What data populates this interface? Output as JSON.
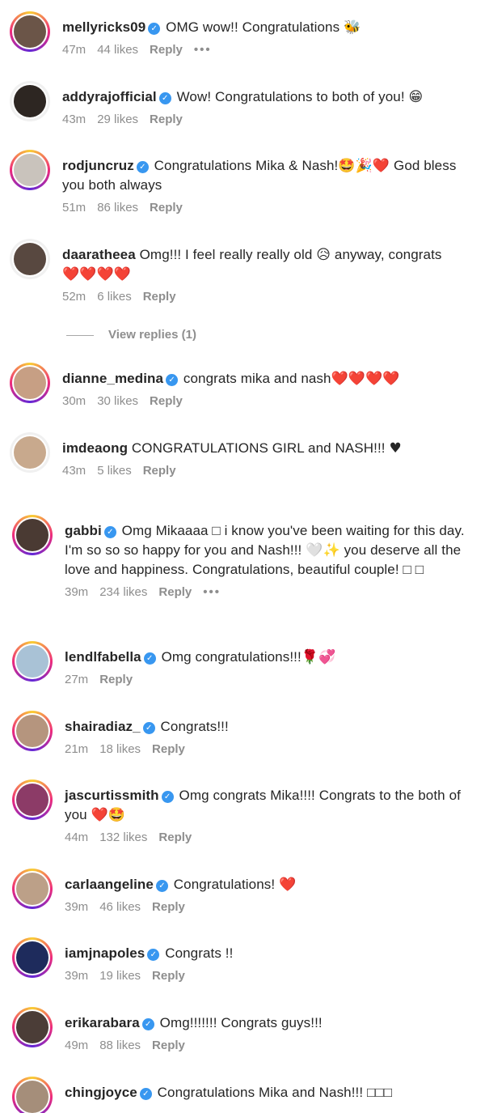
{
  "comments": [
    {
      "username": "mellyricks09",
      "verified": true,
      "text": "OMG wow!! Congratulations",
      "emoji": "🐝",
      "time": "47m",
      "likes": "44 likes",
      "reply": "Reply",
      "more": "•••"
    },
    {
      "username": "addyrajofficial",
      "verified": true,
      "text": "Wow! Congratulations to both of you!",
      "emoji": "😁",
      "time": "43m",
      "likes": "29 likes",
      "reply": "Reply"
    },
    {
      "username": "rodjuncruz",
      "verified": true,
      "text": "Congratulations Mika & Nash!",
      "emoji": "🤩🎉❤️",
      "text2": "God bless you both always",
      "time": "51m",
      "likes": "86 likes",
      "reply": "Reply"
    },
    {
      "username": "daaratheea",
      "verified": false,
      "text": "Omg!!! I feel really really old",
      "emoji": "😥",
      "text2": "anyway, congrats",
      "emoji2": "❤️❤️❤️❤️",
      "time": "52m",
      "likes": "6 likes",
      "reply": "Reply"
    },
    {
      "username": "dianne_medina",
      "verified": true,
      "text": "congrats mika and nash",
      "emoji": "❤️❤️❤️❤️",
      "time": "30m",
      "likes": "30 likes",
      "reply": "Reply"
    },
    {
      "username": "imdeaong",
      "verified": false,
      "text": "CONGRATULATIONS GIRL and NASH!!!",
      "emoji": "♥",
      "time": "43m",
      "likes": "5 likes",
      "reply": "Reply"
    },
    {
      "username": "gabbi",
      "verified": true,
      "text": "Omg Mikaaaa □ i know you've been waiting for this day. I'm so so so happy for you and Nash!!!",
      "emoji": "🤍✨",
      "text2": "you deserve all the love and happiness. Congratulations, beautiful couple! □ □",
      "time": "39m",
      "likes": "234 likes",
      "reply": "Reply",
      "more": "•••"
    },
    {
      "username": "lendlfabella",
      "verified": true,
      "text": "Omg congratulations!!!",
      "emoji": "🌹💞",
      "time": "27m",
      "likes": "",
      "reply": "Reply"
    },
    {
      "username": "shairadiaz_",
      "verified": true,
      "text": "Congrats!!!",
      "time": "21m",
      "likes": "18 likes",
      "reply": "Reply"
    },
    {
      "username": "jascurtissmith",
      "verified": true,
      "text": "Omg congrats Mika!!!! Congrats to the both of you",
      "emoji": "❤️🤩",
      "time": "44m",
      "likes": "132 likes",
      "reply": "Reply"
    },
    {
      "username": "carlaangeline",
      "verified": true,
      "text": "Congratulations!",
      "emoji": "❤️",
      "time": "39m",
      "likes": "46 likes",
      "reply": "Reply"
    },
    {
      "username": "iamjnapoles",
      "verified": true,
      "text": "Congrats !!",
      "time": "39m",
      "likes": "19 likes",
      "reply": "Reply"
    },
    {
      "username": "erikarabara",
      "verified": true,
      "text": "Omg!!!!!!! Congrats guys!!!",
      "time": "49m",
      "likes": "88 likes",
      "reply": "Reply"
    },
    {
      "username": "chingjoyce",
      "verified": true,
      "text": "Congratulations Mika and Nash!!! □□□",
      "time": "",
      "likes": "",
      "reply": ""
    }
  ],
  "view_replies": "View replies (1)",
  "verified_mark": "✓"
}
